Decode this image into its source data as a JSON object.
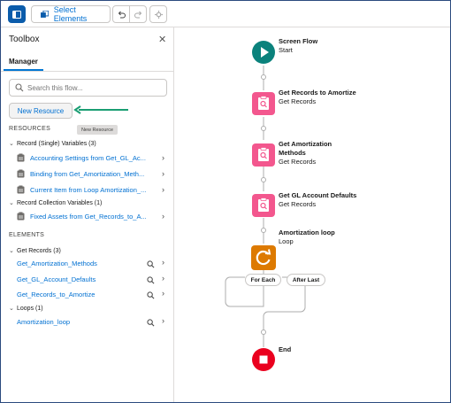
{
  "toolbar": {
    "select_elements_label": "Select Elements",
    "icons": [
      "panel-toggle-icon",
      "select-elements-icon",
      "undo-icon",
      "redo-icon",
      "settings-icon"
    ]
  },
  "sidebar": {
    "title": "Toolbox",
    "close_icon": "close-icon",
    "tab": "Manager",
    "search_placeholder": "Search this flow...",
    "new_resource_label": "New Resource",
    "tooltip": "New Resource",
    "resources_heading": "RESOURCES",
    "resource_groups": [
      {
        "label": "Record (Single) Variables (3)",
        "items": [
          "Accounting Settings from Get_GL_Ac...",
          "Binding from Get_Amortization_Meth...",
          "Current Item from Loop Amortization_..."
        ]
      },
      {
        "label": "Record Collection Variables (1)",
        "items": [
          "Fixed Assets from Get_Records_to_A..."
        ]
      }
    ],
    "elements_heading": "ELEMENTS",
    "element_groups": [
      {
        "label": "Get Records (3)",
        "items": [
          "Get_Amortization_Methods",
          "Get_GL_Account_Defaults",
          "Get_Records_to_Amortize"
        ]
      },
      {
        "label": "Loops (1)",
        "items": [
          "Amortization_loop"
        ]
      }
    ]
  },
  "canvas": {
    "nodes": [
      {
        "title": "Screen Flow",
        "subtitle": "Start",
        "icon": "play-icon",
        "color": "#0b827c"
      },
      {
        "title": "Get Records to Amortize",
        "subtitle": "Get Records",
        "icon": "get-records-icon",
        "color": "#f3578e"
      },
      {
        "title_line1": "Get Amortization",
        "title_line2": "Methods",
        "subtitle": "Get Records",
        "icon": "get-records-icon",
        "color": "#f3578e"
      },
      {
        "title": "Get GL Account Defaults",
        "subtitle": "Get Records",
        "icon": "get-records-icon",
        "color": "#f3578e"
      },
      {
        "title": "Amortization loop",
        "subtitle": "Loop",
        "icon": "loop-icon",
        "color": "#dd7a01"
      },
      {
        "title": "End",
        "icon": "stop-icon",
        "color": "#ea001e"
      }
    ],
    "for_each_label": "For Each",
    "after_last_label": "After Last"
  }
}
